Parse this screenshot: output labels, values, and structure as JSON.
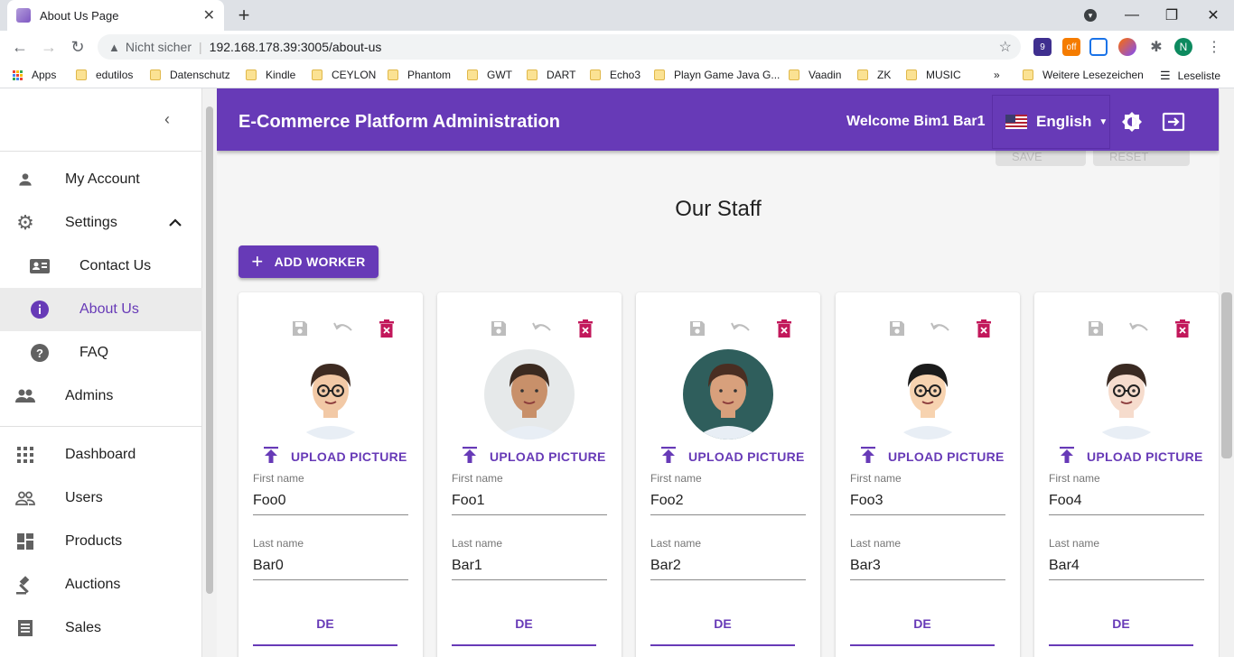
{
  "browser": {
    "tab_title": "About Us Page",
    "not_secure": "Nicht sicher",
    "url": "192.168.178.39:3005/about-us",
    "profile_initial": "N",
    "ext_badge_9": "9",
    "ext_badge_off": "off",
    "bookmarks": [
      "Apps",
      "edutilos",
      "Datenschutz",
      "Kindle",
      "CEYLON",
      "Phantom",
      "GWT",
      "DART",
      "Echo3",
      "Playn Game Java G...",
      "Vaadin",
      "ZK",
      "MUSIC"
    ],
    "more": "»",
    "other_bookmarks": "Weitere Lesezeichen",
    "reading_list": "Leseliste"
  },
  "sidebar": {
    "items": [
      {
        "label": "My Account",
        "icon": "person-icon"
      },
      {
        "label": "Settings",
        "icon": "gear-icon"
      },
      {
        "label": "Contact Us",
        "icon": "contact-card-icon"
      },
      {
        "label": "About Us",
        "icon": "info-icon"
      },
      {
        "label": "FAQ",
        "icon": "help-icon"
      },
      {
        "label": "Admins",
        "icon": "group-icon"
      },
      {
        "label": "Dashboard",
        "icon": "apps-grid-icon"
      },
      {
        "label": "Users",
        "icon": "people-outline-icon"
      },
      {
        "label": "Products",
        "icon": "dashboard-icon"
      },
      {
        "label": "Auctions",
        "icon": "gavel-icon"
      },
      {
        "label": "Sales",
        "icon": "receipt-icon"
      }
    ]
  },
  "appbar": {
    "title": "E-Commerce Platform Administration",
    "welcome": "Welcome Bim1 Bar1",
    "language": "English"
  },
  "page": {
    "save": "SAVE",
    "reset": "RESET",
    "heading": "Our Staff",
    "add_worker": "ADD WORKER",
    "upload_label": "UPLOAD PICTURE",
    "first_name_label": "First name",
    "last_name_label": "Last name",
    "tab_label": "DE"
  },
  "workers": [
    {
      "first": "Foo0",
      "last": "Bar0",
      "hair": "#3e2b22",
      "skin": "#f2c9a6",
      "bg": "#ffffff",
      "glasses": true
    },
    {
      "first": "Foo1",
      "last": "Bar1",
      "hair": "#3b2a20",
      "skin": "#c8906a",
      "bg": "#e6e9ea",
      "glasses": false
    },
    {
      "first": "Foo2",
      "last": "Bar2",
      "hair": "#4a2e22",
      "skin": "#d8a07c",
      "bg": "#2f5e5c",
      "glasses": false
    },
    {
      "first": "Foo3",
      "last": "Bar3",
      "hair": "#1b1b1b",
      "skin": "#f7d3b0",
      "bg": "#ffffff",
      "glasses": true
    },
    {
      "first": "Foo4",
      "last": "Bar4",
      "hair": "#3a2a22",
      "skin": "#f6dccd",
      "bg": "#ffffff",
      "glasses": true
    }
  ],
  "colors": {
    "primary": "#673ab7",
    "danger": "#c2185b"
  }
}
